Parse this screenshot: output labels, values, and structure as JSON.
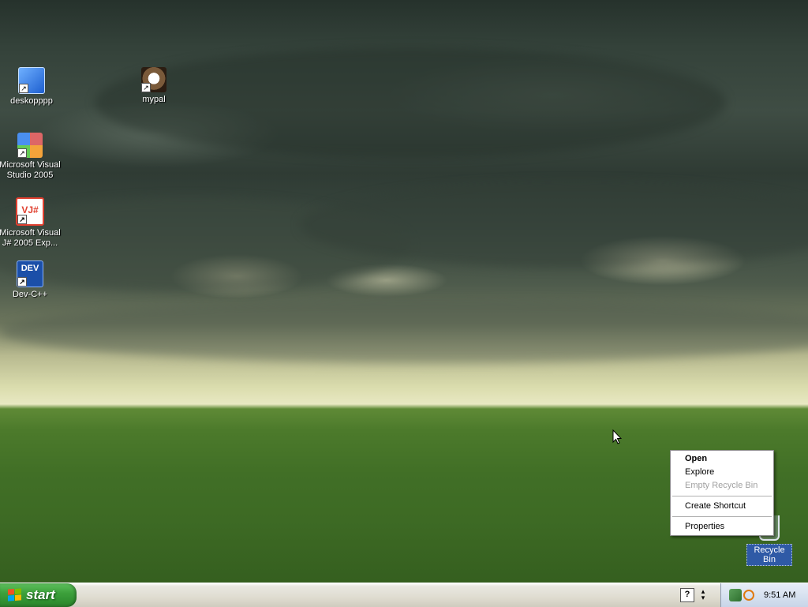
{
  "desktop": {
    "icons": [
      {
        "label": "deskopppp"
      },
      {
        "label": "mypal"
      },
      {
        "label": "Microsoft Visual Studio 2005"
      },
      {
        "label": "Microsoft Visual J# 2005 Exp..."
      },
      {
        "label": "Dev-C++"
      }
    ],
    "recycle_bin": {
      "label": "Recycle Bin"
    },
    "icon_glyphs": {
      "vj": "VJ#",
      "dev": "DEV"
    }
  },
  "context_menu": {
    "items": [
      {
        "label": "Open",
        "state": "default"
      },
      {
        "label": "Explore",
        "state": "enabled"
      },
      {
        "label": "Empty Recycle Bin",
        "state": "disabled"
      },
      {
        "label": "Create Shortcut",
        "state": "enabled"
      },
      {
        "label": "Properties",
        "state": "enabled"
      }
    ]
  },
  "taskbar": {
    "start_label": "start",
    "quick_launch": [
      "help-icon"
    ],
    "clock": "9:51 AM"
  },
  "colors": {
    "taskbar_blue": "#245edb",
    "start_green": "#3da13c",
    "selection_blue": "#2f5aa6"
  }
}
